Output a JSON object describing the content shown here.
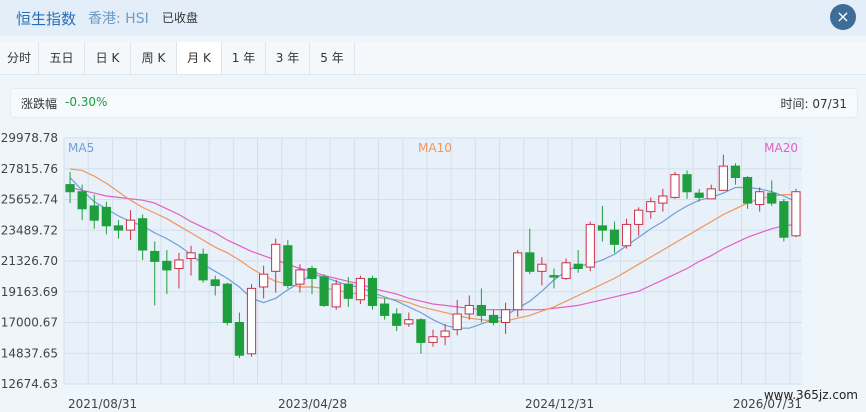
{
  "header": {
    "title": "恒生指数",
    "market": "香港: HSI",
    "status": "已收盘",
    "close": "×"
  },
  "tabs": [
    {
      "label": "分时"
    },
    {
      "label": "五日"
    },
    {
      "label": "日 K"
    },
    {
      "label": "周 K"
    },
    {
      "label": "月 K",
      "active": true
    },
    {
      "label": "1 年"
    },
    {
      "label": "3 年"
    },
    {
      "label": "5 年"
    }
  ],
  "info": {
    "change_label": "涨跌幅",
    "change_value": "-0.30%",
    "time": "时间: 07/31"
  },
  "chart_data": {
    "type": "candlestick",
    "y_ticks": [
      "29978.78",
      "27815.76",
      "25652.74",
      "23489.72",
      "21326.70",
      "19163.69",
      "17000.67",
      "14837.65",
      "12674.63"
    ],
    "ylim": [
      12674.63,
      29978.78
    ],
    "x_labels": [
      "2021/08/31",
      "2023/04/28",
      "2024/12/31",
      "2026/07/31"
    ],
    "ma_labels": [
      "MA5",
      "MA10",
      "MA20"
    ],
    "colors": {
      "up": "#c9324b",
      "down": "#1e9e3c",
      "ma5": "#6ea0d8",
      "ma10": "#f0965a",
      "ma20": "#e35fc2",
      "grid": "#d3e0ec",
      "plot_bg": "#e8f1f9"
    },
    "candles": [
      [
        26700,
        26200,
        27600,
        25400
      ],
      [
        26200,
        25000,
        26700,
        24200
      ],
      [
        25200,
        24200,
        26000,
        23600
      ],
      [
        25100,
        23800,
        25500,
        23200
      ],
      [
        23800,
        23500,
        24200,
        22900
      ],
      [
        23500,
        24200,
        24900,
        22800
      ],
      [
        24300,
        22100,
        24600,
        21400
      ],
      [
        22000,
        21300,
        22700,
        18200
      ],
      [
        21300,
        20700,
        22100,
        19000
      ],
      [
        20800,
        21400,
        21900,
        19400
      ],
      [
        21500,
        21900,
        22400,
        20300
      ],
      [
        21800,
        20000,
        22200,
        19800
      ],
      [
        20000,
        19600,
        20300,
        18900
      ],
      [
        19700,
        17000,
        19800,
        16800
      ],
      [
        17000,
        14700,
        17700,
        14500
      ],
      [
        14800,
        19400,
        19700,
        14600
      ],
      [
        19500,
        20400,
        21000,
        18700
      ],
      [
        20600,
        22500,
        22900,
        19100
      ],
      [
        22400,
        19600,
        22800,
        19400
      ],
      [
        19700,
        20700,
        21100,
        19100
      ],
      [
        20800,
        20100,
        21000,
        19000
      ],
      [
        20200,
        18200,
        20400,
        18100
      ],
      [
        18100,
        19700,
        20000,
        17900
      ],
      [
        19700,
        18700,
        20200,
        18100
      ],
      [
        18600,
        20100,
        20300,
        18300
      ],
      [
        20100,
        18200,
        20300,
        17900
      ],
      [
        18300,
        17500,
        18700,
        17200
      ],
      [
        17600,
        16800,
        18000,
        16400
      ],
      [
        16900,
        17200,
        17700,
        16700
      ],
      [
        17200,
        15600,
        17300,
        14800
      ],
      [
        15600,
        16000,
        16500,
        15300
      ],
      [
        16000,
        16400,
        16900,
        15400
      ],
      [
        16500,
        17600,
        18600,
        16100
      ],
      [
        17600,
        18200,
        18900,
        17200
      ],
      [
        18200,
        17500,
        19400,
        17000
      ],
      [
        17500,
        17000,
        17900,
        16800
      ],
      [
        17000,
        17900,
        18400,
        16200
      ],
      [
        17900,
        21900,
        22100,
        17400
      ],
      [
        21900,
        20600,
        23600,
        20400
      ],
      [
        20600,
        21100,
        21600,
        19600
      ],
      [
        20300,
        20200,
        20800,
        19400
      ],
      [
        20100,
        21200,
        21500,
        20000
      ],
      [
        21100,
        20800,
        22100,
        20500
      ],
      [
        20900,
        23900,
        24100,
        20600
      ],
      [
        23800,
        23500,
        25200,
        22700
      ],
      [
        23500,
        22500,
        24100,
        21900
      ],
      [
        22400,
        23900,
        24300,
        22200
      ],
      [
        23900,
        24900,
        25100,
        23100
      ],
      [
        24800,
        25500,
        25800,
        24300
      ],
      [
        25400,
        25900,
        26400,
        24800
      ],
      [
        25800,
        27400,
        27600,
        25700
      ],
      [
        27400,
        26200,
        27700,
        25700
      ],
      [
        26100,
        25800,
        26400,
        25500
      ],
      [
        25700,
        26400,
        26700,
        25700
      ],
      [
        26300,
        28000,
        28800,
        26300
      ],
      [
        28000,
        27200,
        28200,
        26700
      ],
      [
        27200,
        25400,
        27300,
        25000
      ],
      [
        25300,
        26200,
        26500,
        24800
      ],
      [
        26100,
        25400,
        27000,
        25200
      ],
      [
        25500,
        23000,
        25700,
        22700
      ],
      [
        23100,
        26200,
        26400,
        23000
      ]
    ],
    "ma5": [
      27200,
      26300,
      25500,
      25000,
      24500,
      24100,
      23800,
      23300,
      22900,
      22400,
      21800,
      21100,
      20600,
      20100,
      19500,
      18700,
      18400,
      18700,
      19300,
      19800,
      20400,
      20200,
      19900,
      19600,
      19500,
      19100,
      18800,
      18500,
      18100,
      17700,
      17200,
      16800,
      16600,
      16600,
      16900,
      17200,
      17500,
      18000,
      18500,
      19200,
      20000,
      20600,
      21000,
      21100,
      21400,
      21800,
      22400,
      23000,
      23600,
      24100,
      24700,
      25200,
      25600,
      25800,
      26100,
      26500,
      26500,
      26400,
      26200,
      25900,
      25500
    ],
    "ma10": [
      27800,
      27700,
      27300,
      26800,
      26200,
      25600,
      25100,
      24700,
      24300,
      23800,
      23300,
      22800,
      22300,
      21900,
      21400,
      20800,
      20300,
      19900,
      19700,
      19500,
      19500,
      19400,
      19300,
      19100,
      19000,
      18800,
      18700,
      18600,
      18400,
      18100,
      17900,
      17700,
      17500,
      17300,
      17200,
      17100,
      17100,
      17300,
      17500,
      17800,
      18100,
      18500,
      18900,
      19300,
      19700,
      20100,
      20600,
      21100,
      21600,
      22100,
      22600,
      23100,
      23600,
      24100,
      24600,
      25000,
      25400,
      25700,
      25900,
      26000,
      26000
    ],
    "ma20": [
      26500,
      26300,
      26100,
      25900,
      25800,
      25700,
      25600,
      25400,
      25000,
      24600,
      24100,
      23700,
      23300,
      22800,
      22400,
      22000,
      21700,
      21400,
      21100,
      20800,
      20600,
      20300,
      20100,
      19900,
      19700,
      19400,
      19200,
      19000,
      18700,
      18500,
      18300,
      18200,
      18100,
      18000,
      17900,
      17900,
      17900,
      17900,
      17900,
      17900,
      18000,
      18100,
      18200,
      18400,
      18600,
      18800,
      19000,
      19200,
      19600,
      20000,
      20400,
      20800,
      21300,
      21700,
      22200,
      22600,
      23000,
      23300,
      23600,
      23800,
      23900
    ]
  },
  "watermark": "www.365jz.com"
}
